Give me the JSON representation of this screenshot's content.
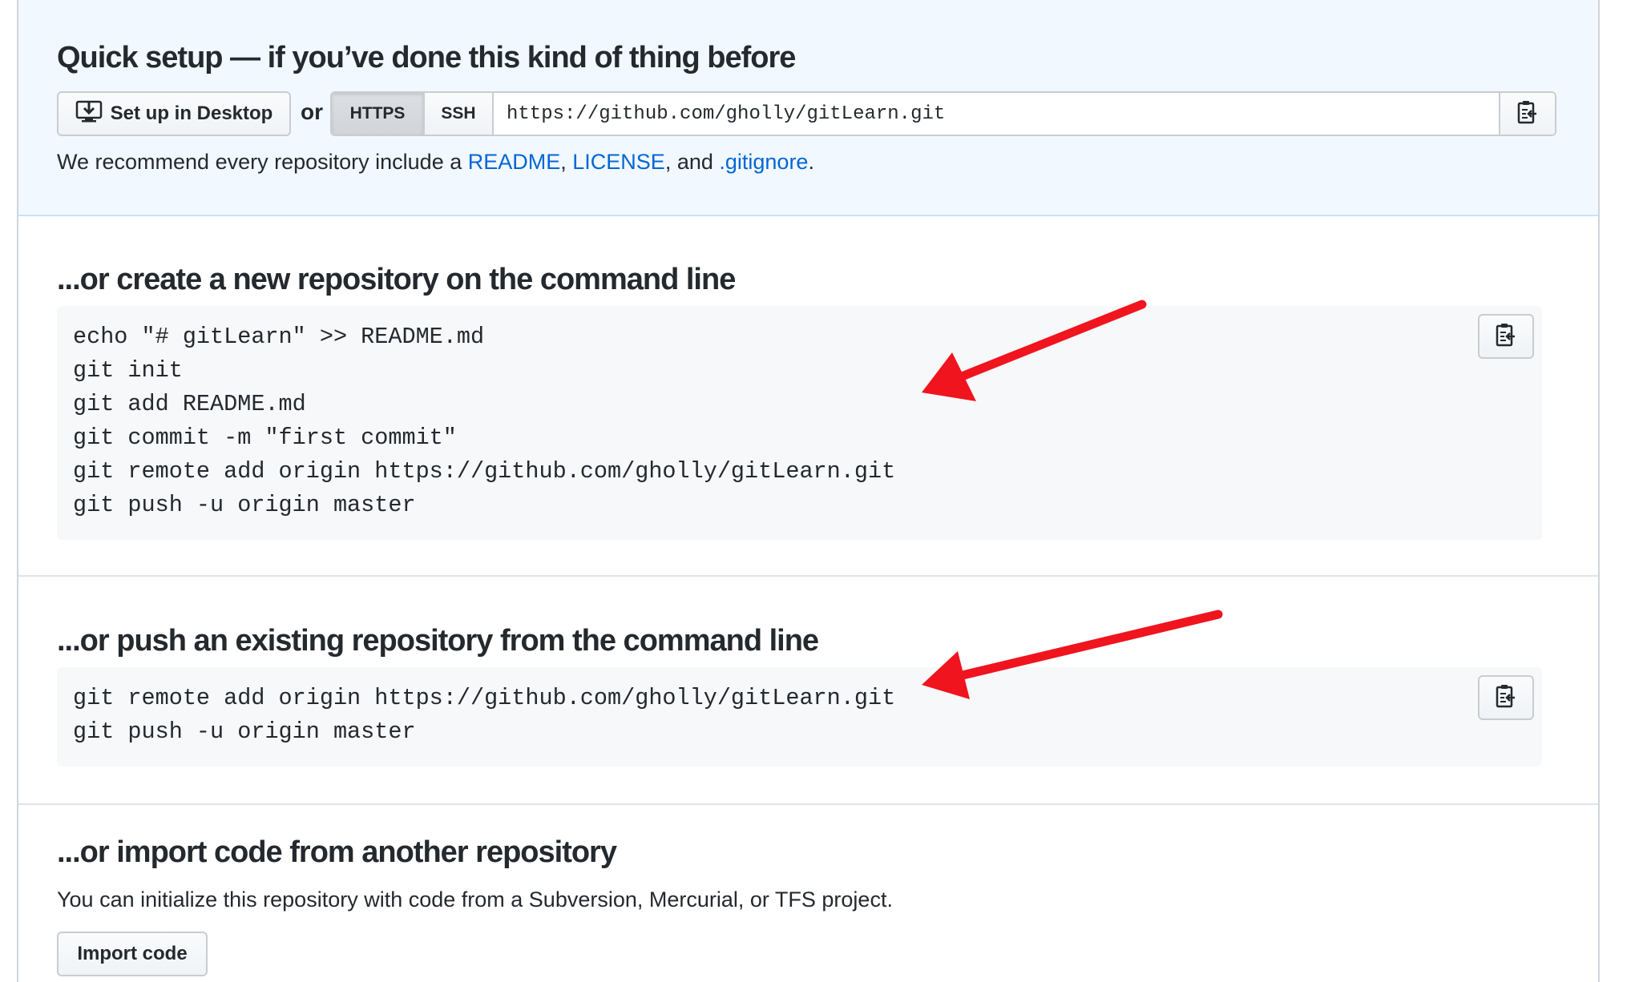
{
  "quick_setup": {
    "title": "Quick setup — if you’ve done this kind of thing before",
    "desktop_button": "Set up in Desktop",
    "or": "or",
    "https": "HTTPS",
    "ssh": "SSH",
    "clone_url": "https://github.com/gholly/gitLearn.git",
    "recommend": {
      "prefix": "We recommend every repository include a ",
      "readme": "README",
      "sep1": ", ",
      "license": "LICENSE",
      "sep2": ", and ",
      "gitignore": ".gitignore",
      "suffix": "."
    }
  },
  "create_new": {
    "title": "...or create a new repository on the command line",
    "lines": [
      "echo \"# gitLearn\" >> README.md",
      "git init",
      "git add README.md",
      "git commit -m \"first commit\"",
      "git remote add origin https://github.com/gholly/gitLearn.git",
      "git push -u origin master"
    ]
  },
  "push_existing": {
    "title": "...or push an existing repository from the command line",
    "lines": [
      "git remote add origin https://github.com/gholly/gitLearn.git",
      "git push -u origin master"
    ]
  },
  "import": {
    "title": "...or import code from another repository",
    "description": "You can initialize this repository with code from a Subversion, Mercurial, or TFS project.",
    "button": "Import code"
  },
  "icons": {
    "desktop": "desktop-download-icon",
    "clipboard": "clipboard-icon",
    "arrow": "red-annotation-arrow"
  },
  "colors": {
    "link": "#0366d6",
    "quick_setup_bg": "#f1f8ff",
    "code_bg": "#f6f8fa",
    "annotation_arrow": "#f0141e"
  }
}
